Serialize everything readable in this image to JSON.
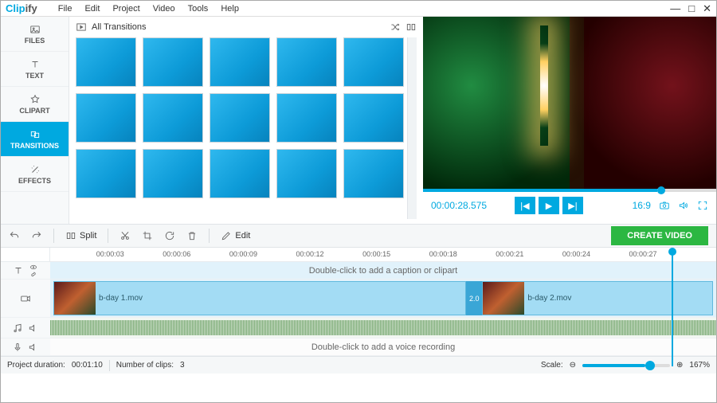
{
  "app": {
    "name_part1": "Clip",
    "name_part2": "ify"
  },
  "menu": {
    "file": "File",
    "edit": "Edit",
    "project": "Project",
    "video": "Video",
    "tools": "Tools",
    "help": "Help"
  },
  "sidebar": {
    "items": [
      {
        "label": "FILES"
      },
      {
        "label": "TEXT"
      },
      {
        "label": "CLIPART"
      },
      {
        "label": "TRANSITIONS"
      },
      {
        "label": "EFFECTS"
      }
    ]
  },
  "panel": {
    "title": "All Transitions"
  },
  "preview": {
    "timecode": "00:00:28.575",
    "aspect": "16:9"
  },
  "toolbar": {
    "split": "Split",
    "edit": "Edit",
    "create": "CREATE VIDEO"
  },
  "ruler": {
    "ticks": [
      "00:00:03",
      "00:00:06",
      "00:00:09",
      "00:00:12",
      "00:00:15",
      "00:00:18",
      "00:00:21",
      "00:00:24",
      "00:00:27"
    ]
  },
  "timeline": {
    "caption_hint": "Double-click to add a caption or clipart",
    "voice_hint": "Double-click to add a voice recording",
    "clip1": "b-day 1.mov",
    "clip2": "b-day 2.mov",
    "trans_dur": "2.0"
  },
  "status": {
    "dur_label": "Project duration:",
    "dur_value": "00:01:10",
    "clips_label": "Number of clips:",
    "clips_value": "3",
    "scale_label": "Scale:",
    "scale_value": "167%"
  }
}
